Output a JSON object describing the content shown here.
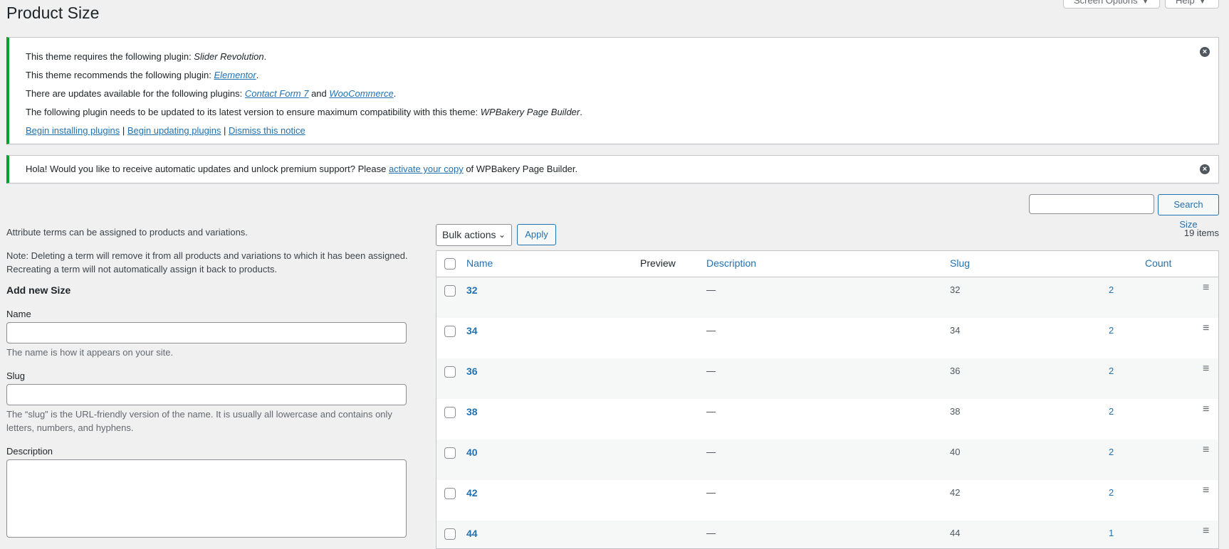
{
  "header": {
    "title": "Product Size",
    "screen_options": "Screen Options",
    "help": "Help"
  },
  "notice1": {
    "line1_prefix": "This theme requires the following plugin: ",
    "line1_plugin": "Slider Revolution",
    "line2_prefix": "This theme recommends the following plugin: ",
    "line2_plugin": "Elementor",
    "line3_prefix": "There are updates available for the following plugins: ",
    "line3_plugin1": "Contact Form 7",
    "line3_and": " and ",
    "line3_plugin2": "WooCommerce",
    "line4_prefix": "The following plugin needs to be updated to its latest version to ensure maximum compatibility with this theme: ",
    "line4_plugin": "WPBakery Page Builder",
    "link_install": "Begin installing plugins",
    "link_update": "Begin updating plugins",
    "link_dismiss": "Dismiss this notice",
    "separator": " | ",
    "period": "."
  },
  "notice2": {
    "prefix": "Hola! Would you like to receive automatic updates and unlock premium support? Please ",
    "link": "activate your copy",
    "suffix": " of WPBakery Page Builder."
  },
  "search": {
    "button": "Search Size",
    "value": ""
  },
  "left": {
    "intro": "Attribute terms can be assigned to products and variations.",
    "note": "Note: Deleting a term will remove it from all products and variations to which it has been assigned. Recreating a term will not automatically assign it back to products.",
    "add_title": "Add new Size",
    "name_label": "Name",
    "name_desc": "The name is how it appears on your site.",
    "slug_label": "Slug",
    "slug_desc": "The “slug” is the URL-friendly version of the name. It is usually all lowercase and contains only letters, numbers, and hyphens.",
    "description_label": "Description"
  },
  "table": {
    "bulk_actions": "Bulk actions",
    "apply": "Apply",
    "items_count": "19 items",
    "columns": {
      "name": "Name",
      "preview": "Preview",
      "description": "Description",
      "slug": "Slug",
      "count": "Count"
    },
    "rows": [
      {
        "name": "32",
        "description": "—",
        "slug": "32",
        "count": "2"
      },
      {
        "name": "34",
        "description": "—",
        "slug": "34",
        "count": "2"
      },
      {
        "name": "36",
        "description": "—",
        "slug": "36",
        "count": "2"
      },
      {
        "name": "38",
        "description": "—",
        "slug": "38",
        "count": "2"
      },
      {
        "name": "40",
        "description": "—",
        "slug": "40",
        "count": "2"
      },
      {
        "name": "42",
        "description": "—",
        "slug": "42",
        "count": "2"
      },
      {
        "name": "44",
        "description": "—",
        "slug": "44",
        "count": "1"
      }
    ]
  },
  "colors": {
    "accent": "#2271b1",
    "notice_border": "#00a32a",
    "background": "#f0f0f1"
  }
}
